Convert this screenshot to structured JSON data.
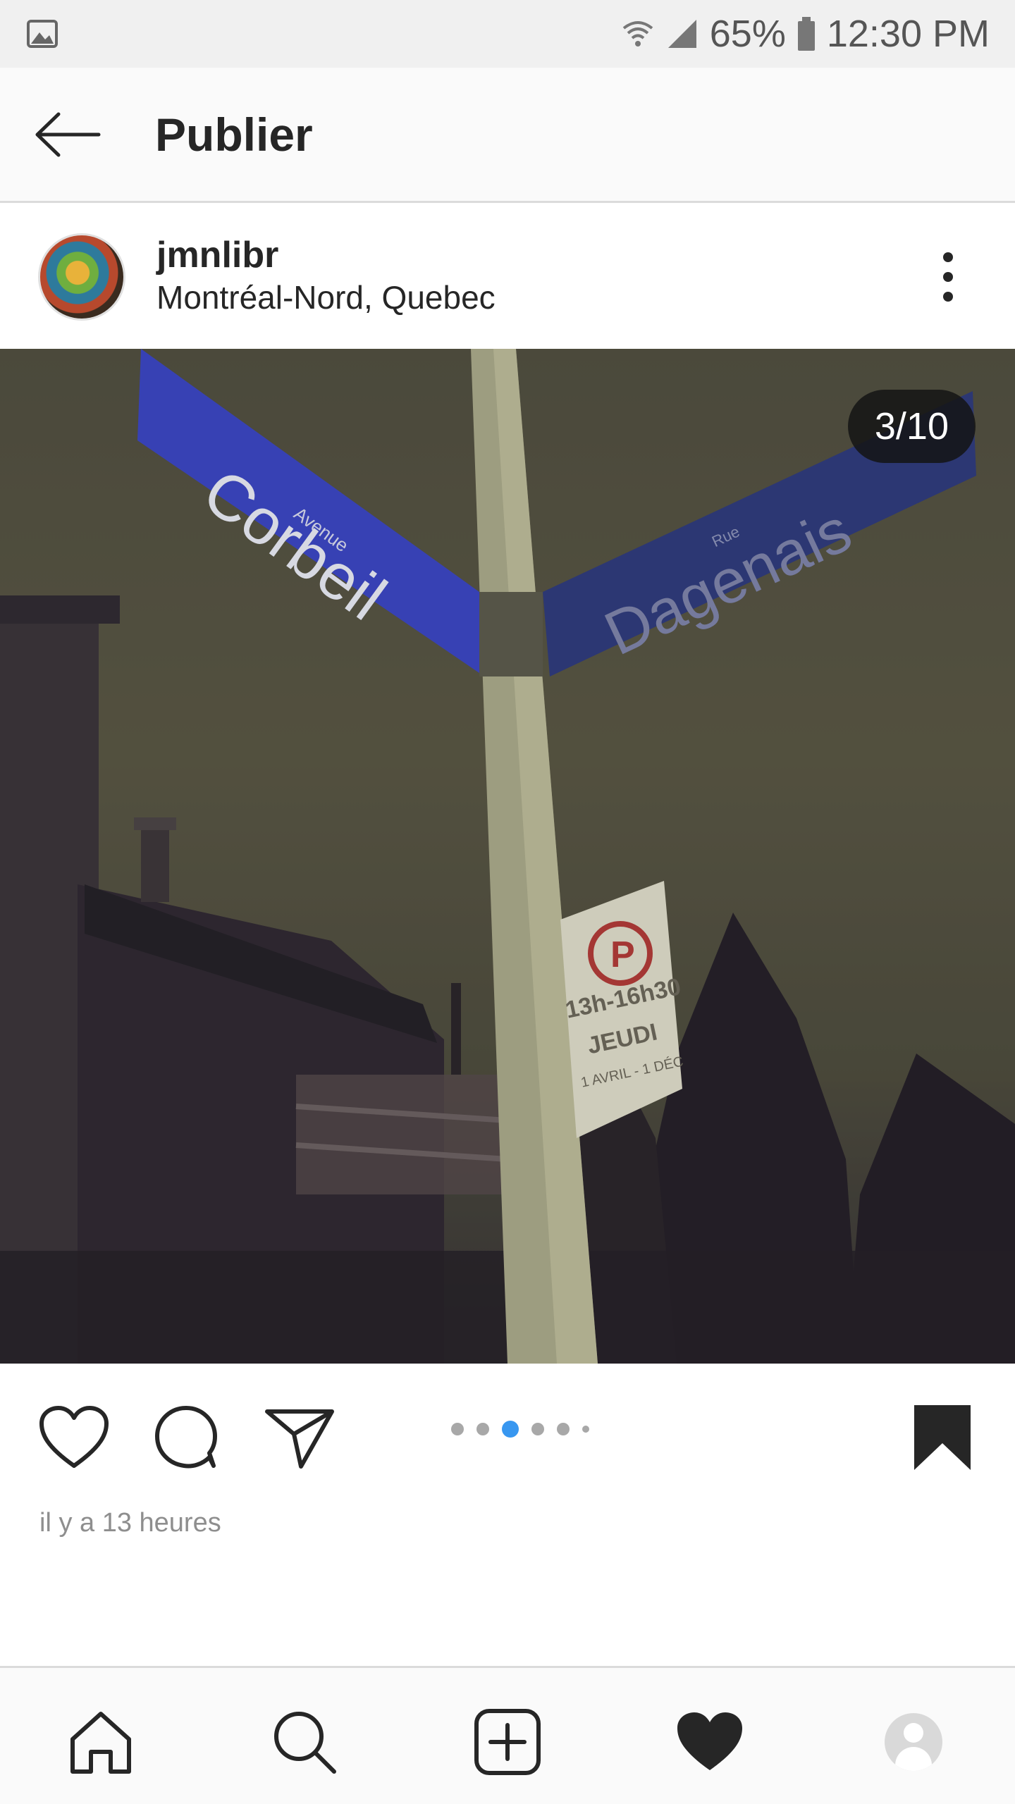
{
  "status_bar": {
    "battery": "65%",
    "time": "12:30 PM",
    "icons": [
      "gallery-icon",
      "wifi-icon",
      "signal-icon",
      "battery-icon"
    ]
  },
  "header": {
    "title": "Publier",
    "back_icon": "arrow-left-icon"
  },
  "post": {
    "username": "jmnlibr",
    "location": "Montréal-Nord, Quebec",
    "image_counter": "3/10",
    "photo_signs": {
      "left_small": "Avenue",
      "left": "Corbeil",
      "right_small": "Rue",
      "right": "Dagenais",
      "parking_time": "13h-16h30",
      "parking_day": "JEUDI",
      "parking_dates": "1 AVRIL - 1 DÉC"
    },
    "carousel": {
      "total_dots": 6,
      "active_index": 2
    },
    "timestamp": "il y a 13 heures"
  },
  "colors": {
    "accent": "#3897f0",
    "text": "#262626",
    "muted": "#8e8e8e"
  },
  "bottom_nav": [
    "home-icon",
    "search-icon",
    "add-post-icon",
    "activity-heart-icon",
    "profile-icon"
  ]
}
